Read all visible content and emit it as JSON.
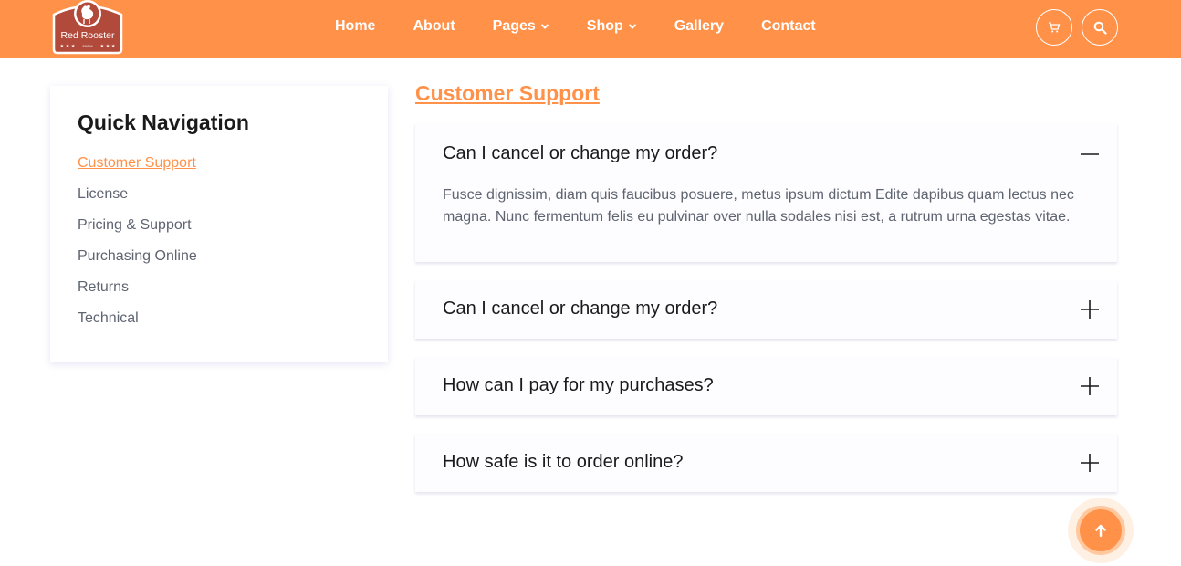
{
  "header": {
    "logo": {
      "brand": "Red Rooster",
      "tagline": "FARM"
    },
    "nav": [
      {
        "label": "Home",
        "has_dropdown": false
      },
      {
        "label": "About",
        "has_dropdown": false
      },
      {
        "label": "Pages",
        "has_dropdown": true
      },
      {
        "label": "Shop",
        "has_dropdown": true
      },
      {
        "label": "Gallery",
        "has_dropdown": false
      },
      {
        "label": "Contact",
        "has_dropdown": false
      }
    ],
    "icons": {
      "cart": "cart-icon",
      "search": "search-icon"
    }
  },
  "sidebar": {
    "title": "Quick Navigation",
    "items": [
      {
        "label": "Customer Support",
        "active": true
      },
      {
        "label": "License",
        "active": false
      },
      {
        "label": "Pricing & Support",
        "active": false
      },
      {
        "label": "Purchasing Online",
        "active": false
      },
      {
        "label": "Returns",
        "active": false
      },
      {
        "label": "Technical",
        "active": false
      }
    ]
  },
  "main": {
    "section_title": "Customer Support",
    "faqs": [
      {
        "question": "Can I cancel or change my order?",
        "expanded": true,
        "answer": "Fusce dignissim, diam quis faucibus posuere, metus ipsum dictum Edite dapibus quam lectus nec magna. Nunc fermentum felis eu pulvinar over nulla sodales nisi est, a rutrum urna egestas vitae."
      },
      {
        "question": "Can I cancel or change my order?",
        "expanded": false
      },
      {
        "question": "How can I pay for my purchases?",
        "expanded": false
      },
      {
        "question": "How safe is it to order online?",
        "expanded": false
      }
    ]
  },
  "colors": {
    "accent": "#ff9149",
    "logo_red": "#b24a3b",
    "text_dark": "#1a1a1a",
    "text_muted": "#5e6470"
  }
}
